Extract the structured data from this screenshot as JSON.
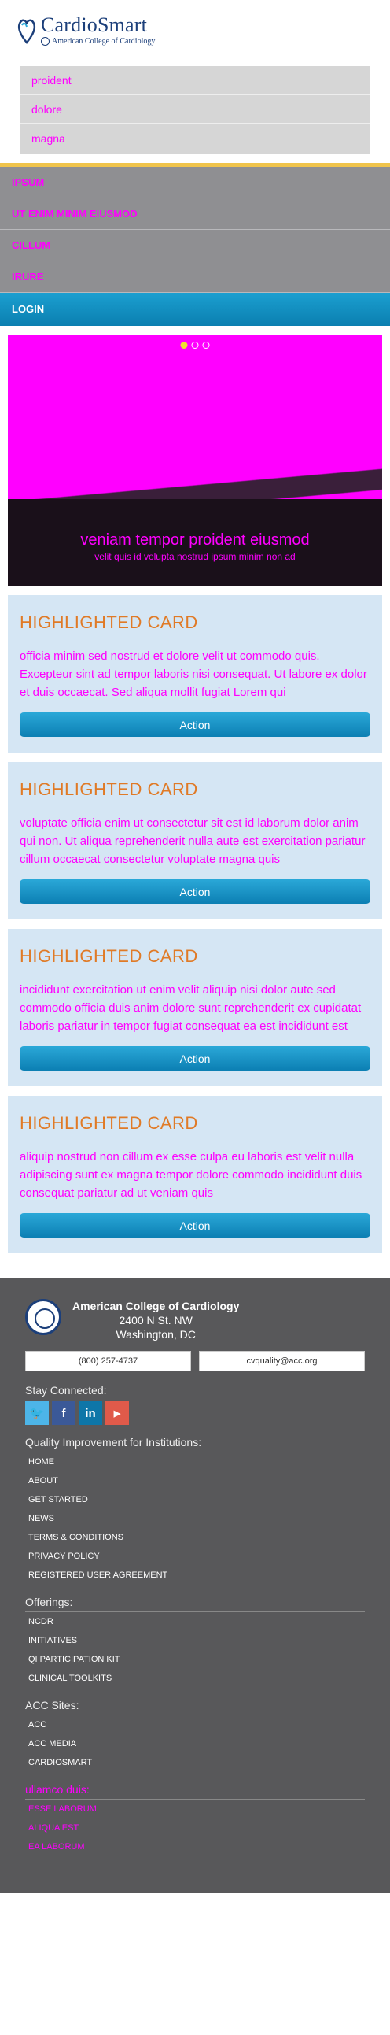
{
  "header": {
    "brand": "CardioSmart",
    "subtitle": "American College of Cardiology"
  },
  "util_menu": [
    "proident",
    "dolore",
    "magna"
  ],
  "nav": {
    "items": [
      "ipsum",
      "ut enim minim eiusmod",
      "cillum",
      "irure"
    ],
    "login": "LOGIN"
  },
  "carousel": {
    "dots": 3,
    "caption_line1": "veniam tempor proident eiusmod",
    "caption_line2": "velit quis id volupta nostrud ipsum minim non ad"
  },
  "cards": [
    {
      "title": "HIGHLIGHTED CARD",
      "body": "officia minim sed nostrud et dolore velit ut commodo quis. Excepteur sint ad tempor laboris nisi consequat. Ut labore ex dolor et duis occaecat. Sed aliqua mollit fugiat Lorem qui",
      "action": "Action"
    },
    {
      "title": "HIGHLIGHTED CARD",
      "body": "voluptate officia enim ut consectetur sit est id laborum dolor anim qui non. Ut aliqua reprehenderit nulla aute est exercitation pariatur cillum occaecat consectetur voluptate magna quis",
      "action": "Action"
    },
    {
      "title": "HIGHLIGHTED CARD",
      "body": "incididunt exercitation ut enim velit aliquip nisi dolor aute sed commodo officia duis anim dolore sunt reprehenderit ex cupidatat laboris pariatur in tempor fugiat consequat ea est incididunt est",
      "action": "Action"
    },
    {
      "title": "HIGHLIGHTED CARD",
      "body": "aliquip nostrud non cillum ex esse culpa eu laboris est velit nulla adipiscing sunt ex magna tempor dolore commodo incididunt duis consequat pariatur ad ut veniam quis",
      "action": "Action"
    }
  ],
  "footer": {
    "org_name": "American College of Cardiology",
    "org_street": "2400 N St. NW",
    "org_city": "Washington, DC",
    "phone": "(800) 257-4737",
    "email": "cvquality@acc.org",
    "stay_connected": "Stay Connected:",
    "socials": [
      "twitter-icon",
      "facebook-icon",
      "linkedin-icon",
      "youtube-icon"
    ],
    "section1_title": "Quality Improvement for Institutions:",
    "section1_links": [
      "HOME",
      "ABOUT",
      "GET STARTED",
      "NEWS",
      "TERMS & CONDITIONS",
      "PRIVACY POLICY",
      "REGISTERED USER AGREEMENT"
    ],
    "section2_title": "Offerings:",
    "section2_links": [
      "NCDR",
      "INITIATIVES",
      "QI PARTICIPATION KIT",
      "CLINICAL TOOLKITS"
    ],
    "section3_title": "ACC Sites:",
    "section3_links": [
      "ACC",
      "ACC MEDIA",
      "CARDIOSMART"
    ],
    "section4_title": "ullamco duis:",
    "section4_links": [
      "esse laborum",
      "aliqua est",
      "ea laborum"
    ]
  },
  "colors": {
    "accent_orange": "#e07a26",
    "nav_gold": "#f0c44c",
    "action_blue": "#0c7fb3",
    "card_bg": "#d5e6f4",
    "footer_bg": "#58585a"
  }
}
